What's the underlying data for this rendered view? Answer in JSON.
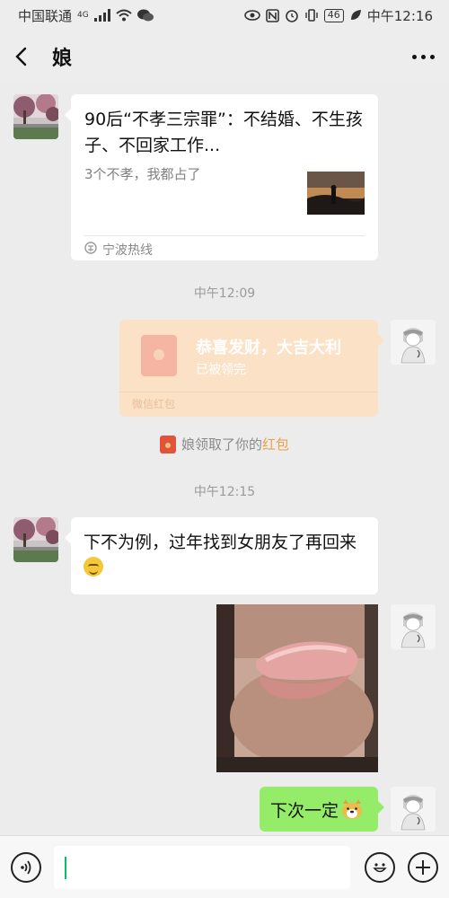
{
  "status_bar": {
    "carrier": "中国联通",
    "network": "4G",
    "battery": "46",
    "time": "中午12:16"
  },
  "header": {
    "title": "娘",
    "back_icon": "chevron-left-icon",
    "more_icon": "ellipsis-icon"
  },
  "messages": {
    "article": {
      "title": "90后“不孝三宗罪”：不结婚、不生孩子、不回家工作...",
      "description": "3个不孝，我都占了",
      "source": "宁波热线"
    },
    "time_1": "中午12:09",
    "red_packet": {
      "title": "恭喜发财，大吉大利",
      "status": "已被领完",
      "brand": "微信红包"
    },
    "system": {
      "text": "娘领取了你的",
      "link": "红包"
    },
    "time_2": "中午12:15",
    "mom_text": "下不为例，过年找到女朋友了再回来",
    "my_text": "下次一定"
  },
  "input": {
    "voice_icon": "voice-icon",
    "emoji_icon": "emoji-icon",
    "add_icon": "plus-icon"
  },
  "colors": {
    "background": "#ececec",
    "my_bubble": "#95ec69",
    "red_packet": "#fbe1c6",
    "link": "#eba14a",
    "caret": "#07c160"
  }
}
